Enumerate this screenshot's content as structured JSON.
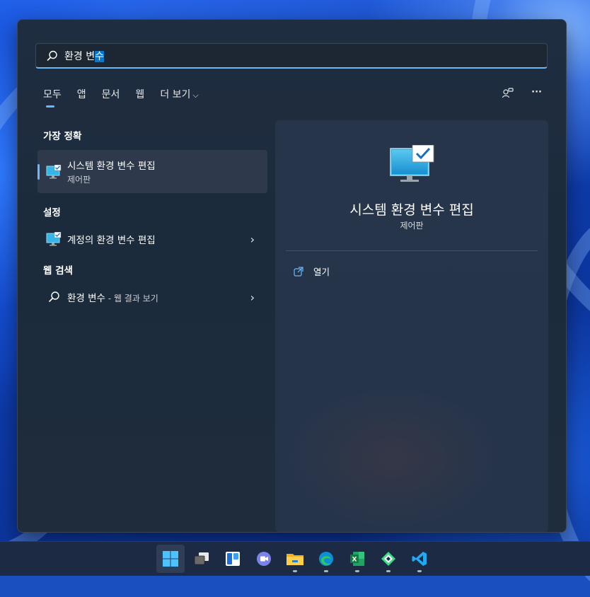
{
  "search": {
    "query_text": "환경 변",
    "query_selected": "수"
  },
  "tabs": [
    {
      "label": "모두"
    },
    {
      "label": "앱"
    },
    {
      "label": "문서"
    },
    {
      "label": "웹"
    },
    {
      "label": "더 보기"
    }
  ],
  "top_icons": {
    "account_icon": "people-connect-icon",
    "more_icon": "ellipsis-icon",
    "more_glyph": "···"
  },
  "sections": {
    "best_match": "가장 정확",
    "settings": "설정",
    "web_search": "웹 검색"
  },
  "best_match": {
    "title": "시스템 환경 변수 편집",
    "subtitle": "제어판"
  },
  "settings_item": {
    "prefix": "계정의 ",
    "title_bold": "환경 변수 편집"
  },
  "web_item": {
    "title": "환경 변수",
    "suffix": " - 웹 결과 보기"
  },
  "preview": {
    "title": "시스템 환경 변수 편집",
    "subtitle": "제어판",
    "action_open": "열기"
  },
  "taskbar": {
    "apps": [
      "windows-start-icon",
      "task-view-icon",
      "widgets-icon",
      "teams-chat-icon",
      "file-explorer-icon",
      "edge-icon",
      "excel-icon",
      "android-studio-icon",
      "vscode-icon"
    ]
  },
  "colors": {
    "accent": "#6cb8f6",
    "selection": "#0078d4"
  }
}
